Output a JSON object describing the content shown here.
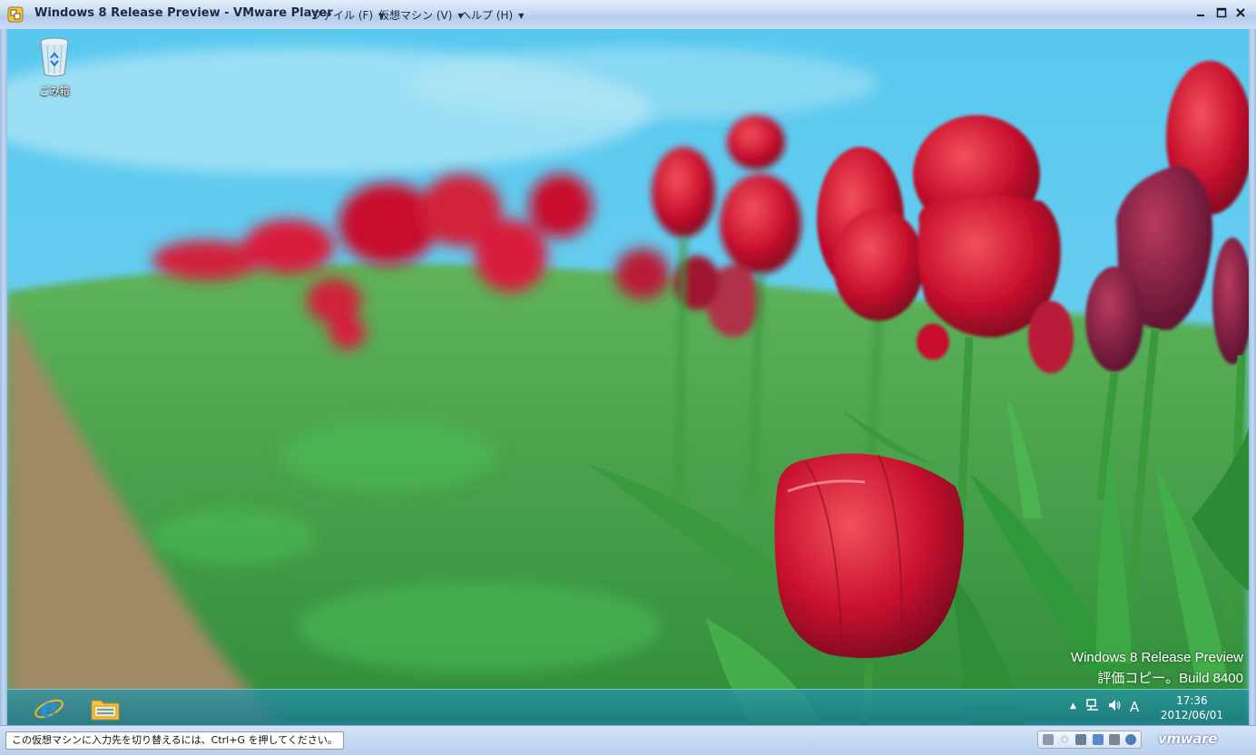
{
  "window": {
    "title": "Windows 8 Release Preview - VMware Player",
    "menus": [
      {
        "label": "ファイル (F)"
      },
      {
        "label": "仮想マシン (V)"
      },
      {
        "label": "ヘルプ (H)"
      }
    ],
    "controls": [
      "minimize-icon",
      "maximize-icon",
      "close-icon"
    ]
  },
  "desktop": {
    "icons": [
      {
        "label": "ごみ箱",
        "icon": "recycle-bin-icon"
      }
    ],
    "watermark": {
      "line1": "Windows 8 Release Preview",
      "line2": "評価コピー。Build 8400"
    }
  },
  "taskbar": {
    "pinned": [
      {
        "name": "internet-explorer",
        "icon": "internet-explorer-icon"
      },
      {
        "name": "file-explorer",
        "icon": "folder-icon"
      }
    ],
    "tray": {
      "show_hidden": "▲",
      "ime": "A",
      "time": "17:36",
      "date": "2012/06/01"
    }
  },
  "statusbar": {
    "hint": "この仮想マシンに入力先を切り替えるには、Ctrl+G を押してください。",
    "devices": [
      "hard-disk-icon",
      "cd-icon",
      "floppy-icon",
      "network-icon",
      "printer-icon",
      "sound-icon"
    ],
    "brand": "vmware"
  },
  "colors": {
    "sky": "#4fc3ea",
    "tulip": "#c8102e",
    "leaf": "#2f9a3a",
    "taskbar": "#1f8a9c"
  }
}
